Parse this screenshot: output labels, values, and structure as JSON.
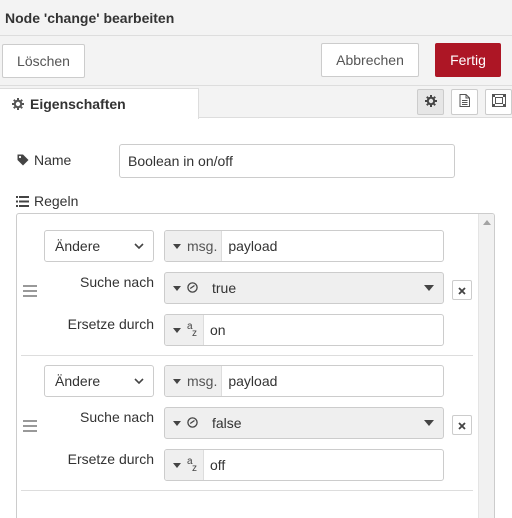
{
  "header": {
    "title": "Node 'change' bearbeiten"
  },
  "buttons": {
    "delete": "Löschen",
    "cancel": "Abbrechen",
    "done": "Fertig"
  },
  "tabs": {
    "properties": "Eigenschaften"
  },
  "icons": {
    "properties_tab": "gear-icon",
    "description_tab": "document-icon",
    "appearance_tab": "frame-icon",
    "name": "tag-icon",
    "rules": "list-icon",
    "rule_handle": "drag-handle-icon",
    "remove_rule": "close-icon",
    "boolean_type": "toggle-icon",
    "string_type": "az-icon"
  },
  "form": {
    "name_label": "Name",
    "name_value": "Boolean in on/off",
    "rules_label": "Regeln"
  },
  "rules": [
    {
      "action": "Ändere",
      "prop_prefix": "msg.",
      "prop_value": "payload",
      "search_label": "Suche nach",
      "search_value": "true",
      "replace_label": "Ersetze durch",
      "replace_value": "on"
    },
    {
      "action": "Ändere",
      "prop_prefix": "msg.",
      "prop_value": "payload",
      "search_label": "Suche nach",
      "search_value": "false",
      "replace_label": "Ersetze durch",
      "replace_value": "off"
    }
  ],
  "colors": {
    "primary_button": "#ad1625",
    "toolbar_bg": "#f3f3f3",
    "border": "#cccccc"
  }
}
